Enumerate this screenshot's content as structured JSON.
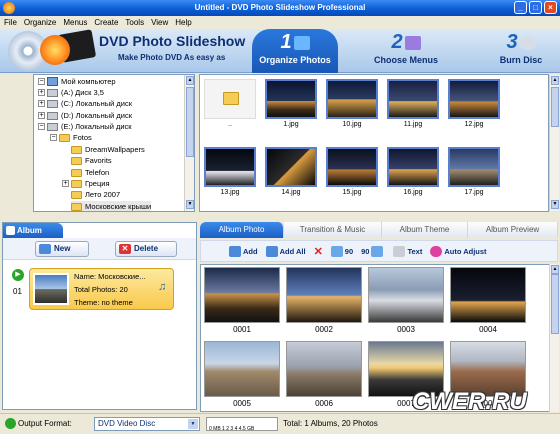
{
  "window": {
    "title": "Untitled - DVD Photo Slideshow Professional"
  },
  "menu": [
    "File",
    "Organize",
    "Menus",
    "Create",
    "Tools",
    "View",
    "Help"
  ],
  "banner": {
    "title": "DVD Photo Slideshow",
    "subtitle": "Make Photo DVD As easy as",
    "steps": [
      {
        "num": "1",
        "label": "Organize Photos"
      },
      {
        "num": "2",
        "label": "Choose Menus"
      },
      {
        "num": "3",
        "label": "Burn Disc"
      }
    ]
  },
  "tree": {
    "items": [
      {
        "label": "Мой компьютер",
        "icon": "computer-icon",
        "expander": "−"
      },
      {
        "label": "(A:) Диск 3,5",
        "icon": "floppy-icon",
        "expander": "+"
      },
      {
        "label": "(C:) Локальный диск",
        "icon": "drive-icon",
        "expander": "+"
      },
      {
        "label": "(D:) Локальный диск",
        "icon": "drive-icon",
        "expander": "+"
      },
      {
        "label": "(E:) Локальный диск",
        "icon": "drive-icon",
        "expander": "−"
      },
      {
        "label": "Fotos",
        "icon": "folder-icon",
        "expander": "−"
      },
      {
        "label": "DreamWallpapers",
        "icon": "folder-icon",
        "expander": ""
      },
      {
        "label": "Favorits",
        "icon": "folder-icon",
        "expander": ""
      },
      {
        "label": "Telefon",
        "icon": "folder-icon",
        "expander": ""
      },
      {
        "label": "Греция",
        "icon": "folder-icon",
        "expander": "+"
      },
      {
        "label": "Лето 2007",
        "icon": "folder-icon",
        "expander": ""
      },
      {
        "label": "Московские крыши",
        "icon": "folder-icon",
        "expander": ""
      }
    ]
  },
  "browser": {
    "items": [
      {
        "label": "..",
        "kind": "folder"
      },
      {
        "label": "1.jpg"
      },
      {
        "label": "10.jpg"
      },
      {
        "label": "11.jpg"
      },
      {
        "label": "12.jpg"
      },
      {
        "label": "13.jpg"
      },
      {
        "label": "14.jpg"
      },
      {
        "label": "15.jpg"
      },
      {
        "label": "16.jpg"
      },
      {
        "label": "17.jpg"
      }
    ]
  },
  "album": {
    "tab": "Album",
    "new_label": "New",
    "delete_label": "Delete",
    "index": "01",
    "name": "Name: Московские...",
    "total": "Total Photos: 20",
    "theme": "Theme: no theme"
  },
  "panel_tabs": [
    "Album Photo",
    "Transition & Music",
    "Album Theme",
    "Album Preview"
  ],
  "toolbar": {
    "add": "Add",
    "add_all": "Add All",
    "rot_left": "90",
    "rot_right": "90",
    "text": "Text",
    "auto_adjust": "Auto Adjust"
  },
  "photos": [
    {
      "label": "0001"
    },
    {
      "label": "0002"
    },
    {
      "label": "0003"
    },
    {
      "label": "0004"
    },
    {
      "label": "0005"
    },
    {
      "label": "0006"
    },
    {
      "label": "0007"
    },
    {
      "label": "0008"
    }
  ],
  "status": {
    "output_label": "Output Format:",
    "output_value": "DVD Video Disc",
    "meter": "0 MB 1 2 3 4 4.5 GB",
    "total": "Total: 1 Albums, 20 Photos"
  },
  "watermark": "CWER.RU",
  "colors": {
    "accent": "#1b5fc7",
    "title_blue": "#0d2f73",
    "album_item": "#f9c94a"
  }
}
